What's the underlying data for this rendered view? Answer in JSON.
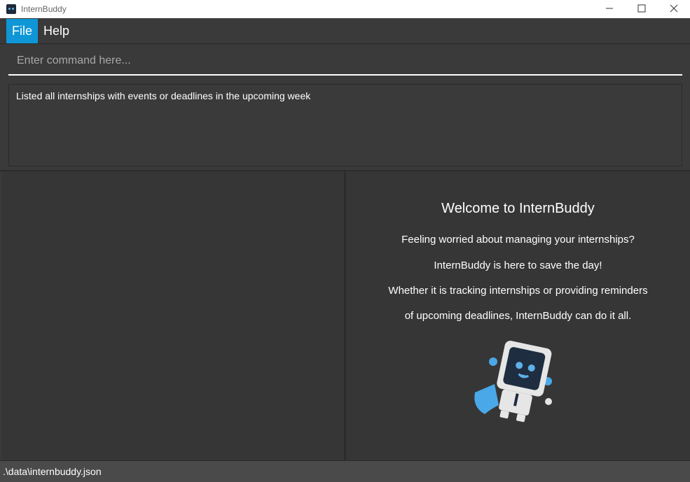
{
  "window": {
    "title": "InternBuddy",
    "minimize": "—",
    "maximize": "☐",
    "close": "✕"
  },
  "menu": {
    "items": [
      {
        "label": "File",
        "active": true
      },
      {
        "label": "Help",
        "active": false
      }
    ]
  },
  "command": {
    "placeholder": "Enter command here...",
    "value": ""
  },
  "result": {
    "message": "Listed all internships with events or deadlines in the upcoming week"
  },
  "welcome": {
    "title": "Welcome to InternBuddy",
    "lines": [
      "Feeling worried about managing your internships?",
      "InternBuddy is here to save the day!",
      "Whether it is tracking internships or providing reminders",
      "of upcoming deadlines, InternBuddy can do it all."
    ]
  },
  "status": {
    "path": ".\\data\\internbuddy.json"
  },
  "colors": {
    "accent": "#0f96d6",
    "background": "#3a3a3a",
    "panel": "#363636"
  }
}
